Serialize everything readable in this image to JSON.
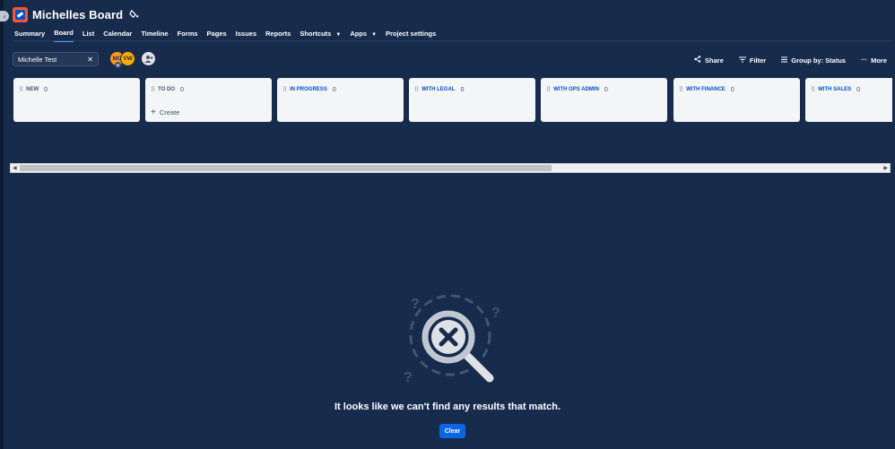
{
  "header": {
    "title": "Michelles Board"
  },
  "tabs": [
    {
      "label": "Summary"
    },
    {
      "label": "Board"
    },
    {
      "label": "List"
    },
    {
      "label": "Calendar"
    },
    {
      "label": "Timeline"
    },
    {
      "label": "Forms"
    },
    {
      "label": "Pages"
    },
    {
      "label": "Issues"
    },
    {
      "label": "Reports"
    },
    {
      "label": "Shortcuts"
    },
    {
      "label": "Apps"
    },
    {
      "label": "Project settings"
    }
  ],
  "active_tab": "Board",
  "search": {
    "value": "Michelle Test"
  },
  "avatars": [
    {
      "initials": "MC",
      "badge": "M"
    },
    {
      "initials": "VW"
    }
  ],
  "toolbar": {
    "share": "Share",
    "filter": "Filter",
    "group_by": "Group by: Status",
    "more": "More"
  },
  "columns": [
    {
      "name": "NEW",
      "count": "0"
    },
    {
      "name": "TO DO",
      "count": "0",
      "create_label": "Create"
    },
    {
      "name": "IN PROGRESS",
      "count": "0"
    },
    {
      "name": "WITH LEGAL",
      "count": "0"
    },
    {
      "name": "WITH OPS ADMIN",
      "count": "0"
    },
    {
      "name": "WITH FINANCE",
      "count": "0"
    },
    {
      "name": "WITH SALES",
      "count": "0"
    }
  ],
  "empty_state": {
    "message": "It looks like we can't find any results that match.",
    "clear_label": "Clear"
  },
  "colors": {
    "background": "#172b4d",
    "accent": "#0c66e4",
    "column_bg": "#f4f5f7",
    "status_blue": "#0052cc"
  },
  "icons": {
    "sidebar_toggle": "chevron-left-icon",
    "project": "project-logo-icon",
    "title_action": "paint-bucket-icon",
    "share": "share-icon",
    "filter": "filter-icon",
    "group_by": "group-icon",
    "more": "ellipsis-icon",
    "add_people": "add-people-icon",
    "drag": "drag-handle-icon",
    "empty": "magnifier-x-icon"
  }
}
